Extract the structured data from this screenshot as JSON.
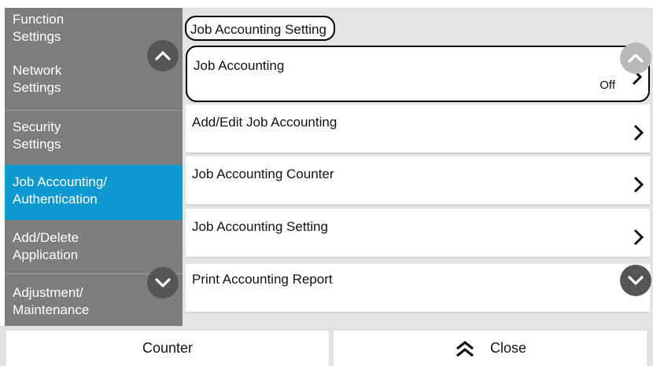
{
  "sidebar": {
    "items": [
      {
        "line1": "Function",
        "line2": "Settings"
      },
      {
        "line1": "Network",
        "line2": "Settings"
      },
      {
        "line1": "Security",
        "line2": "Settings"
      },
      {
        "line1": "Job Accounting/",
        "line2": "Authentication"
      },
      {
        "line1": "Add/Delete",
        "line2": "Application"
      },
      {
        "line1": "Adjustment/",
        "line2": "Maintenance"
      }
    ],
    "active_index": 3,
    "scroll_up_icon": "chevron-up-icon",
    "scroll_down_icon": "chevron-down-icon"
  },
  "main": {
    "breadcrumb": "Job Accounting Setting",
    "items": [
      {
        "title": "Job Accounting",
        "value": "Off"
      },
      {
        "title": "Add/Edit Job Accounting",
        "value": ""
      },
      {
        "title": "Job Accounting Counter",
        "value": ""
      },
      {
        "title": "Job Accounting Setting",
        "value": ""
      },
      {
        "title": "Print Accounting Report",
        "value": ""
      }
    ]
  },
  "bottom": {
    "counter_label": "Counter",
    "close_label": "Close",
    "close_icon": "double-chevron-up-icon"
  },
  "colors": {
    "sidebar_bg": "#7d7d7d",
    "sidebar_active": "#0b99cf",
    "list_bg": "#e4e4e4",
    "highlight_outline": "#000000"
  }
}
